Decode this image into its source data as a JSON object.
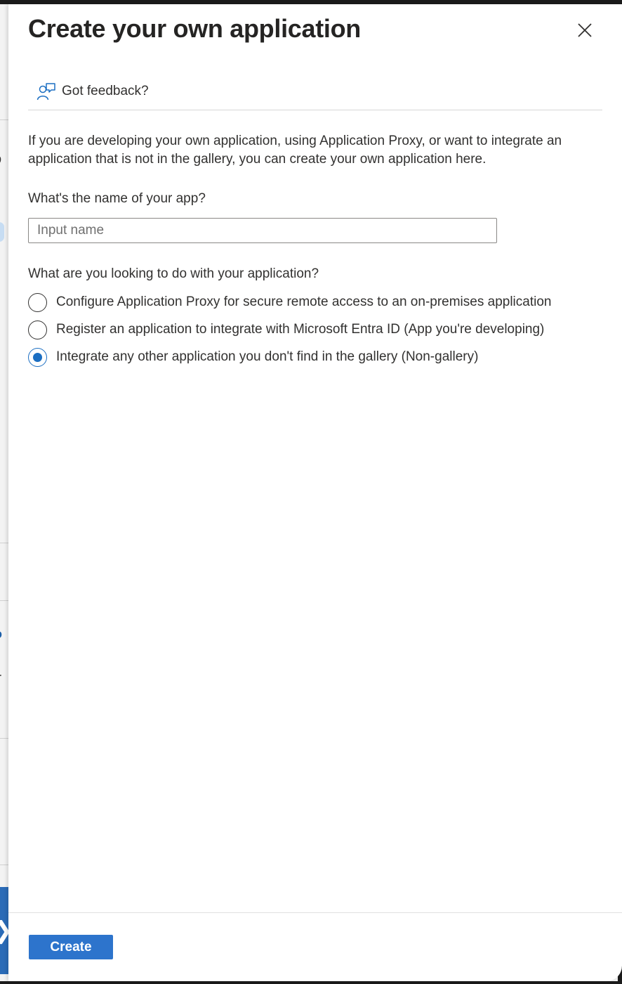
{
  "background": {
    "fragments": [
      "p",
      "ti",
      "o",
      "l,",
      "ir"
    ],
    "arrow_glyph": "❯"
  },
  "dialog": {
    "title": "Create your own application",
    "close_icon": "close-icon",
    "feedback_label": "Got feedback?",
    "feedback_icon": "feedback-person-icon",
    "intro": "If you are developing your own application, using Application Proxy, or want to integrate an application that is not in the gallery, you can create your own application here.",
    "name_question": "What's the name of your app?",
    "name_input": {
      "value": "",
      "placeholder": "Input name"
    },
    "purpose_question": "What are you looking to do with your application?",
    "options": [
      {
        "label": "Configure Application Proxy for secure remote access to an on-premises application",
        "checked": false
      },
      {
        "label": "Register an application to integrate with Microsoft Entra ID (App you're developing)",
        "checked": false
      },
      {
        "label": "Integrate any other application you don't find in the gallery (Non-gallery)",
        "checked": true
      }
    ],
    "create_label": "Create"
  },
  "colors": {
    "accent": "#2d74cc",
    "radio_checked": "#1b6ec2",
    "text": "#323130"
  }
}
